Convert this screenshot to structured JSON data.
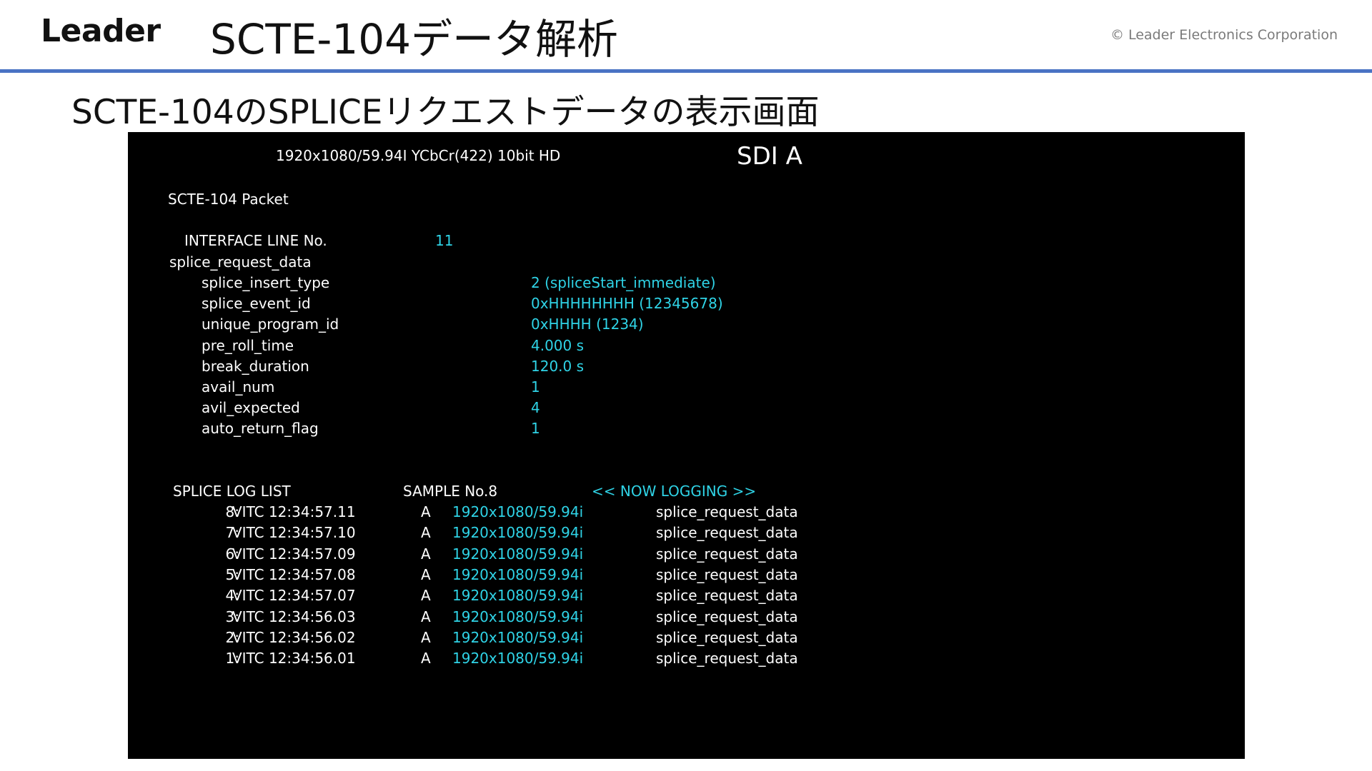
{
  "header": {
    "logo": "Leader",
    "title": "SCTE-104データ解析",
    "copyright": "© Leader Electronics Corporation"
  },
  "subtitle": "SCTE-104のSPLICEリクエストデータの表示画面",
  "screen": {
    "format": "1920x1080/59.94I YCbCr(422) 10bit HD",
    "input": "SDI A",
    "packet_label": "SCTE-104 Packet",
    "interface_line": {
      "label": "INTERFACE LINE No.",
      "value": "11"
    },
    "section": "splice_request_data",
    "fields": [
      {
        "label": "splice_insert_type",
        "value": "2 (spliceStart_immediate)"
      },
      {
        "label": "splice_event_id",
        "value": "0xHHHHHHHH (12345678)"
      },
      {
        "label": "unique_program_id",
        "value": "0xHHHH (1234)"
      },
      {
        "label": "pre_roll_time",
        "value": "4.000 s"
      },
      {
        "label": "break_duration",
        "value": "120.0 s"
      },
      {
        "label": "avail_num",
        "value": "1"
      },
      {
        "label": "avil_expected",
        "value": "4"
      },
      {
        "label": "auto_return_flag",
        "value": "1"
      }
    ],
    "log": {
      "title": "SPLICE LOG LIST",
      "sample": "SAMPLE No.8",
      "status": "<< NOW LOGGING >>",
      "rows": [
        {
          "index": "8:",
          "time": "VITC 12:34:57.11",
          "input": "A",
          "format": "1920x1080/59.94i",
          "type": "splice_request_data"
        },
        {
          "index": "7:",
          "time": "VITC 12:34:57.10",
          "input": "A",
          "format": "1920x1080/59.94i",
          "type": "splice_request_data"
        },
        {
          "index": "6:",
          "time": "VITC 12:34:57.09",
          "input": "A",
          "format": "1920x1080/59.94i",
          "type": "splice_request_data"
        },
        {
          "index": "5:",
          "time": "VITC 12:34:57.08",
          "input": "A",
          "format": "1920x1080/59.94i",
          "type": "splice_request_data"
        },
        {
          "index": "4:",
          "time": "VITC 12:34:57.07",
          "input": "A",
          "format": "1920x1080/59.94i",
          "type": "splice_request_data"
        },
        {
          "index": "3:",
          "time": "VITC 12:34:56.03",
          "input": "A",
          "format": "1920x1080/59.94i",
          "type": "splice_request_data"
        },
        {
          "index": "2:",
          "time": "VITC 12:34:56.02",
          "input": "A",
          "format": "1920x1080/59.94i",
          "type": "splice_request_data"
        },
        {
          "index": "1:",
          "time": "VITC 12:34:56.01",
          "input": "A",
          "format": "1920x1080/59.94i",
          "type": "splice_request_data"
        }
      ]
    },
    "colors": {
      "accent": "#2fd3e6",
      "rule": "#4a73c4"
    }
  }
}
